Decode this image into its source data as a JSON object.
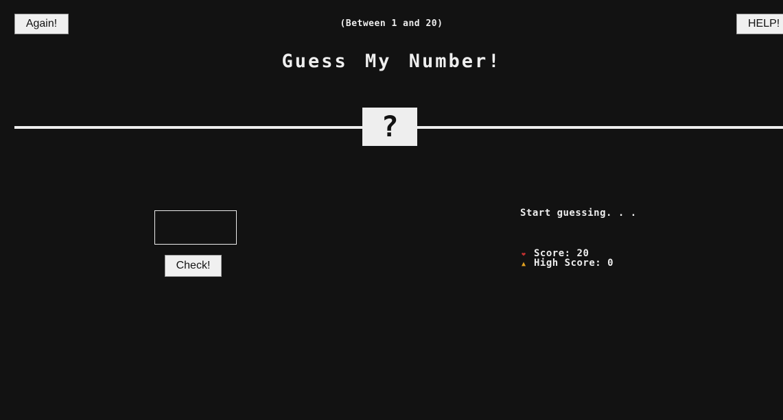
{
  "header": {
    "again_label": "Again!",
    "range_text": "(Between 1 and 20)",
    "help_label": "HELP!"
  },
  "title": "Guess My Number!",
  "secret_number_display": "?",
  "guess": {
    "value": "",
    "check_label": "Check!"
  },
  "message": "Start guessing. . .",
  "stats": {
    "score_label": "Score:",
    "score_value": "20",
    "high_score_label": "High Score:",
    "high_score_value": "0",
    "score_icon": "heart-icon",
    "high_score_icon": "trophy-icon"
  },
  "colors": {
    "background": "#121212",
    "foreground": "#eeeeee"
  }
}
